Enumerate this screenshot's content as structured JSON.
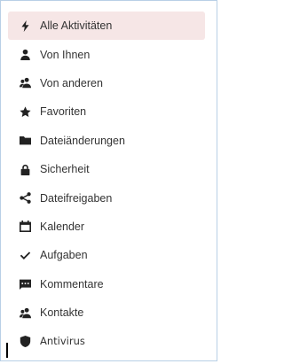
{
  "colors": {
    "active_bg": "#f6e6e6",
    "icon": "#222222",
    "text": "#333333",
    "frame_border": "#b8cfe6"
  },
  "menu": {
    "items": [
      {
        "label": "Alle Aktivitäten",
        "icon": "lightning-icon",
        "active": true
      },
      {
        "label": "Von Ihnen",
        "icon": "user-icon",
        "active": false
      },
      {
        "label": "Von anderen",
        "icon": "users-icon",
        "active": false
      },
      {
        "label": "Favoriten",
        "icon": "star-icon",
        "active": false
      },
      {
        "label": "Dateiänderungen",
        "icon": "folder-icon",
        "active": false
      },
      {
        "label": "Sicherheit",
        "icon": "lock-icon",
        "active": false
      },
      {
        "label": "Dateifreigaben",
        "icon": "share-icon",
        "active": false
      },
      {
        "label": "Kalender",
        "icon": "calendar-icon",
        "active": false
      },
      {
        "label": "Aufgaben",
        "icon": "checkmark-icon",
        "active": false
      },
      {
        "label": "Kommentare",
        "icon": "comment-icon",
        "active": false
      },
      {
        "label": "Kontakte",
        "icon": "contacts-icon",
        "active": false
      },
      {
        "label": "Antivirus",
        "icon": "shield-icon",
        "active": false
      }
    ]
  }
}
